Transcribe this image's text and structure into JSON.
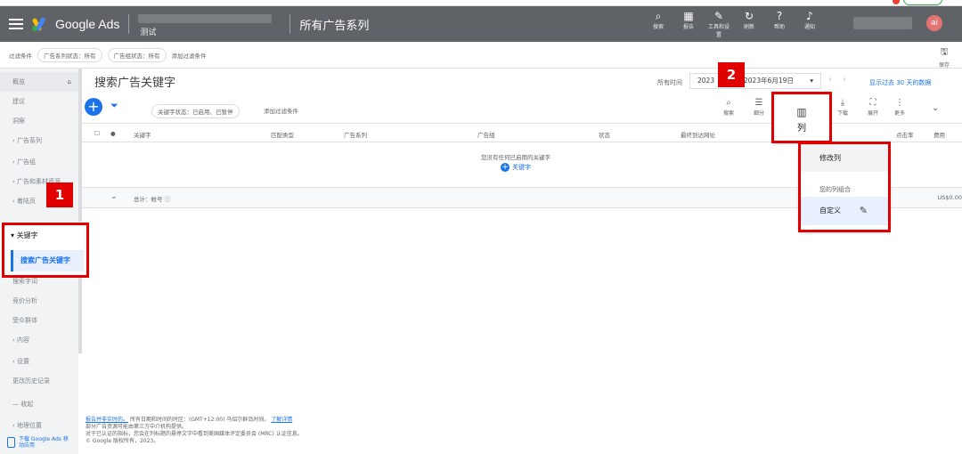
{
  "header": {
    "brand": "Google Ads",
    "account_sub": "测试",
    "campaign_title": "所有广告系列",
    "avatar_letter": "ai",
    "tools": [
      {
        "icon": "⌕",
        "label": "搜索"
      },
      {
        "icon": "▦",
        "label": "报告"
      },
      {
        "icon": "✎",
        "label": "工具和设置"
      },
      {
        "icon": "↻",
        "label": "刷新"
      },
      {
        "icon": "?",
        "label": "帮助"
      },
      {
        "icon": "♪",
        "label": "通知"
      }
    ]
  },
  "filterbar": {
    "label": "过滤条件",
    "chip1": "广告系列状态：所有",
    "chip2": "广告组状态：所有",
    "add": "添加过滤条件",
    "save": "保存"
  },
  "sidebar": {
    "items": [
      "概览",
      "建议",
      "洞察",
      "广告系列",
      "广告组",
      "广告和素材资源",
      "着陆页"
    ],
    "keywords_header": "关键字",
    "search_keywords": "搜索广告关键字",
    "items_below": [
      "搜索字词",
      "竞价分析",
      "受众群体",
      "内容",
      "设置",
      "更改历史记录"
    ],
    "collapse": "收起",
    "location": "地理位置",
    "mobile_app": "下载 Google Ads 移动应用"
  },
  "main": {
    "title": "搜索广告关键字",
    "daterange_label": "所有时间",
    "date_start": "2023",
    "date_end": "2023年6月19日",
    "compare": "显示过去 30 天的数据",
    "kw_status_chip": "关键字状态：已启用、已暂停",
    "add_filter": "添加过滤条件",
    "tools": [
      {
        "icon": "⌕",
        "label": "搜索"
      },
      {
        "icon": "☰",
        "label": "细分"
      },
      {
        "icon": "⤓",
        "label": "下载"
      },
      {
        "icon": "⛶",
        "label": "展开"
      },
      {
        "icon": "⋮",
        "label": "更多"
      }
    ],
    "columns": [
      "关键字",
      "匹配类型",
      "广告系列",
      "广告组",
      "状态",
      "最终到达网址",
      "点击率",
      "费用"
    ],
    "empty_message": "您没有任何已启用的关键字",
    "add_keyword": "关键字",
    "total_label": "总计：帐号",
    "total_cost": "US$0.00"
  },
  "popups": {
    "columns_label": "列",
    "modify_columns": "修改列",
    "your_column_sets": "您的列组合",
    "custom": "自定义"
  },
  "annotations": {
    "badge1": "1",
    "badge2": "2"
  },
  "footer": {
    "line1_link": "报告并非实时的。",
    "line1_text": "所有日期和时间的时区：(GMT+12:00) 马绍尔群岛时间。",
    "line1_link2": "了解详情",
    "line2": "部分广告资源可能由第三方中介机构提供。",
    "line3": "对于已认证的指标，您会在列标题的悬停文字中看到美国媒体评定委员会 (MRC) 认证信息。",
    "line4": "© Google 版权所有，2023。"
  }
}
